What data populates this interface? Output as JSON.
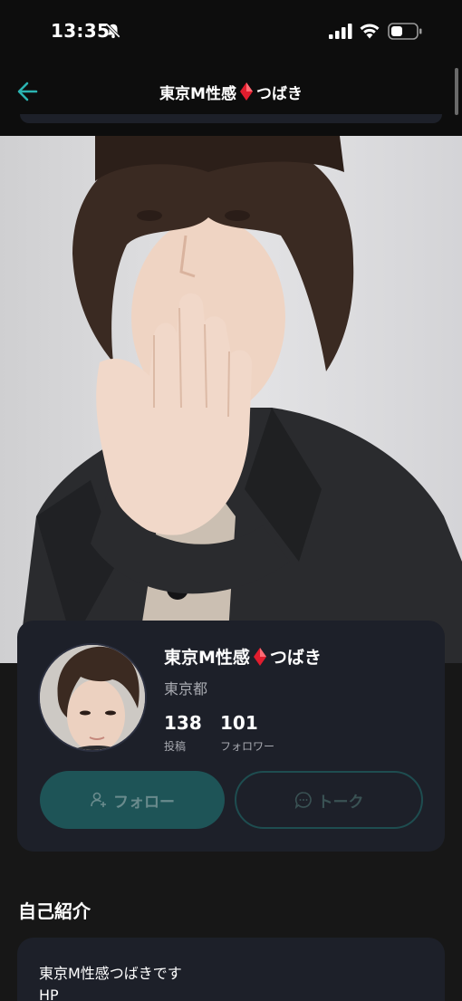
{
  "status_bar": {
    "time": "13:35"
  },
  "header": {
    "title_part1": "東京M性感",
    "title_part2": "つばき"
  },
  "profile": {
    "name_part1": "東京M性感",
    "name_part2": "つばき",
    "location": "東京都",
    "posts_count": "138",
    "posts_label": "投稿",
    "followers_count": "101",
    "followers_label": "フォロワー",
    "follow_label": "フォロー",
    "talk_label": "トーク"
  },
  "bio": {
    "section_title": "自己紹介",
    "line1": "東京M性感つばきです",
    "line2": "HP"
  },
  "colors": {
    "accent": "#1e5457",
    "card": "#1d2029",
    "diamond": "#e11d2e",
    "back_arrow": "#2bb3b1"
  }
}
